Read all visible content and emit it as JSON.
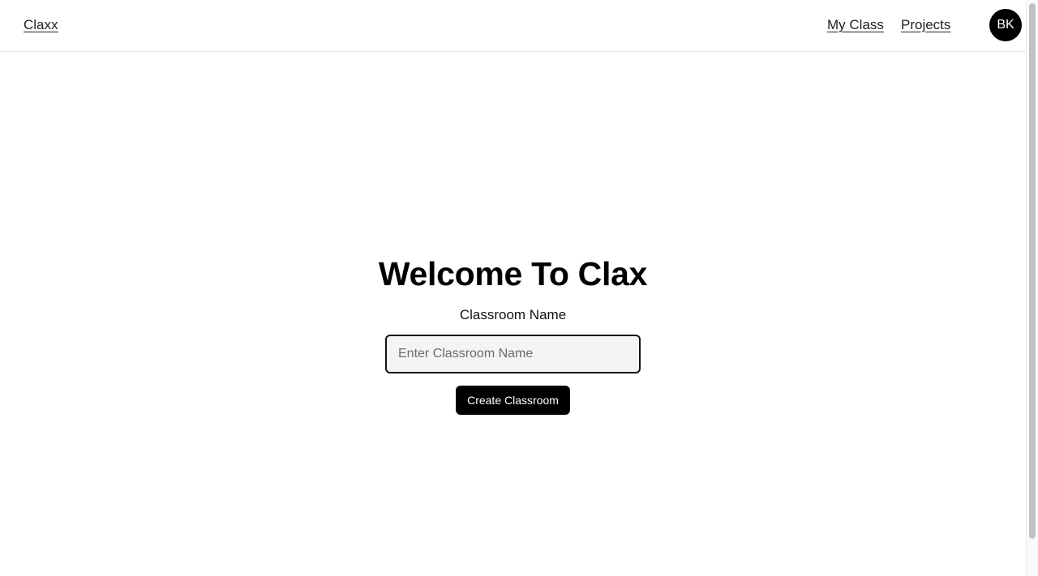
{
  "navbar": {
    "brand": "Claxx",
    "links": [
      "My Class",
      "Projects"
    ],
    "avatar_initials": "BK"
  },
  "main": {
    "title": "Welcome To Clax",
    "field_label": "Classroom Name",
    "input_placeholder": "Enter Classroom Name",
    "input_value": "",
    "button_label": "Create Classroom"
  },
  "colors": {
    "primary": "#000000",
    "input_background": "#f4f4f4",
    "border_light": "#e5e5e5"
  }
}
